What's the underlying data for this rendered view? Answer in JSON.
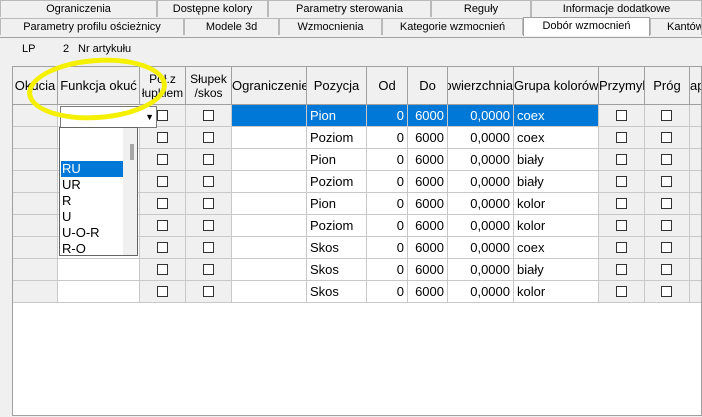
{
  "tabs_row1": [
    "Ograniczenia",
    "Dostępne kolory",
    "Parametry sterowania",
    "Reguły",
    "Informacje dodatkowe"
  ],
  "tabs_row2": [
    "Parametry profilu ościeżnicy",
    "Modele 3d",
    "Wzmocnienia",
    "Kategorie wzmocnień",
    "Dobór wzmocnień",
    "Kantów"
  ],
  "active_tab": "Dobór wzmocnień",
  "panel_header": {
    "lp": "LP",
    "value": "2",
    "article": "Nr artykułu"
  },
  "columns": [
    "Okucia",
    "Funkcja okuć",
    "Poł.z łupkiem",
    "Słupek /skos",
    "Ograniczenie",
    "Pozycja",
    "Od",
    "Do",
    "Powierzchnia",
    "Grupa kolorów",
    "Przymyk",
    "Próg",
    "ap"
  ],
  "column_header_labels": {
    "col0": "Okucia",
    "col1": "Funkcja okuć",
    "col2_l1": "Poł.z",
    "col2_l2": "łupkiem",
    "col3_l1": "Słupek",
    "col3_l2": "/skos",
    "col4": "Ograniczenie",
    "col5": "Pozycja",
    "col6": "Od",
    "col7": "Do",
    "col8": "Powierzchnia",
    "col9": "Grupa kolorów",
    "col10": "Przymyk",
    "col11": "Próg",
    "col12": "ap"
  },
  "rows": [
    {
      "pozycja": "Pion",
      "od": "0",
      "do": "6000",
      "pow": "0,0000",
      "grupa": "coex"
    },
    {
      "pozycja": "Poziom",
      "od": "0",
      "do": "6000",
      "pow": "0,0000",
      "grupa": "coex"
    },
    {
      "pozycja": "Pion",
      "od": "0",
      "do": "6000",
      "pow": "0,0000",
      "grupa": "biały"
    },
    {
      "pozycja": "Poziom",
      "od": "0",
      "do": "6000",
      "pow": "0,0000",
      "grupa": "biały"
    },
    {
      "pozycja": "Pion",
      "od": "0",
      "do": "6000",
      "pow": "0,0000",
      "grupa": "kolor"
    },
    {
      "pozycja": "Poziom",
      "od": "0",
      "do": "6000",
      "pow": "0,0000",
      "grupa": "kolor"
    },
    {
      "pozycja": "Skos",
      "od": "0",
      "do": "6000",
      "pow": "0,0000",
      "grupa": "coex"
    },
    {
      "pozycja": "Skos",
      "od": "0",
      "do": "6000",
      "pow": "0,0000",
      "grupa": "biały"
    },
    {
      "pozycja": "Skos",
      "od": "0",
      "do": "6000",
      "pow": "0,0000",
      "grupa": "kolor"
    }
  ],
  "dropdown_options": [
    "RU",
    "UR",
    "R",
    "U",
    "U-O-R",
    "R-O"
  ],
  "dropdown_selected": "RU",
  "colors": {
    "selection": "#0078d7",
    "annotation": "#f5f000"
  }
}
